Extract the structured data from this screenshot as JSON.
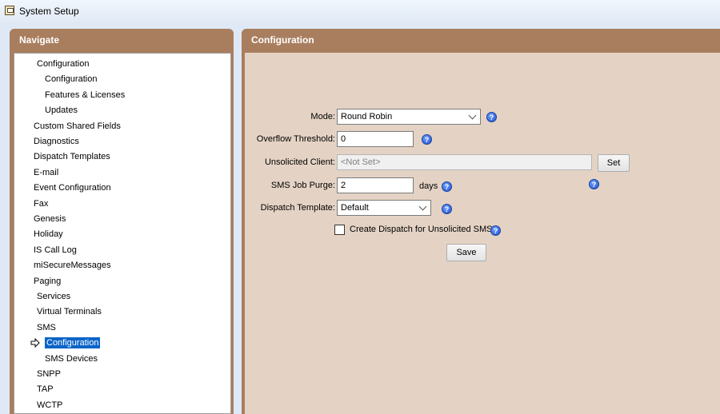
{
  "window": {
    "title": "System Setup",
    "icon": "app-window-icon"
  },
  "navigate": {
    "header": "Navigate",
    "items": [
      {
        "label": "Configuration",
        "level": 1
      },
      {
        "label": "Configuration",
        "level": 2
      },
      {
        "label": "Features & Licenses",
        "level": 2
      },
      {
        "label": "Updates",
        "level": 2
      },
      {
        "label": "Custom Shared Fields",
        "level": 0
      },
      {
        "label": "Diagnostics",
        "level": 0
      },
      {
        "label": "Dispatch Templates",
        "level": 0
      },
      {
        "label": "E-mail",
        "level": 0
      },
      {
        "label": "Event Configuration",
        "level": 0
      },
      {
        "label": "Fax",
        "level": 0
      },
      {
        "label": "Genesis",
        "level": 0
      },
      {
        "label": "Holiday",
        "level": 0
      },
      {
        "label": "IS Call Log",
        "level": 0
      },
      {
        "label": "miSecureMessages",
        "level": 0
      },
      {
        "label": "Paging",
        "level": 0
      },
      {
        "label": "Services",
        "level": 1
      },
      {
        "label": "Virtual Terminals",
        "level": 1
      },
      {
        "label": "SMS",
        "level": 1
      },
      {
        "label": "Configuration",
        "level": 2,
        "selected": true
      },
      {
        "label": "SMS Devices",
        "level": 2
      },
      {
        "label": "SNPP",
        "level": 1
      },
      {
        "label": "TAP",
        "level": 1
      },
      {
        "label": "WCTP",
        "level": 1
      }
    ]
  },
  "configuration": {
    "header": "Configuration",
    "mode": {
      "label": "Mode:",
      "value": "Round Robin"
    },
    "overflow": {
      "label": "Overflow Threshold:",
      "value": "0"
    },
    "unsolicited": {
      "label": "Unsolicited Client:",
      "value": "<Not Set>",
      "set_label": "Set"
    },
    "purge": {
      "label": "SMS Job Purge:",
      "value": "2",
      "unit": "days"
    },
    "template": {
      "label": "Dispatch Template:",
      "value": "Default"
    },
    "create_dispatch": {
      "label": "Create Dispatch for Unsolicited SMS",
      "checked": false
    },
    "save_label": "Save",
    "help_glyph": "?"
  },
  "colors": {
    "accent": "#a97e5f",
    "content_bg": "#e4d3c4",
    "selection": "#0a64c8"
  }
}
